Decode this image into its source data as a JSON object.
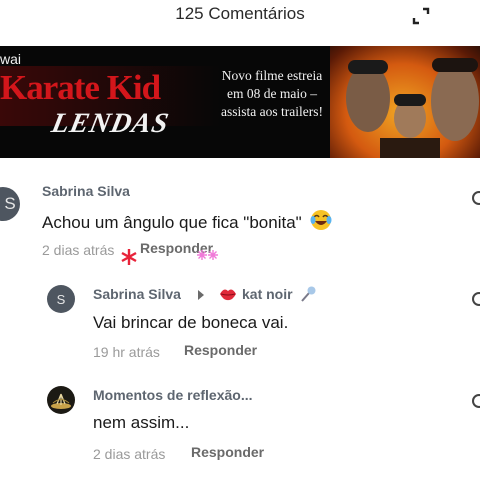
{
  "header": {
    "title": "125 Comentários"
  },
  "banner": {
    "brand": "wai",
    "movie_title": "Karate Kid",
    "movie_subtitle": "LENDAS",
    "promo_text": "Novo filme estreia em 08 de maio – assista aos trailers!"
  },
  "comments": [
    {
      "author": "Sabrina Silva",
      "avatar_letter": "S",
      "text": "Achou um ângulo que fica \"bonita\"",
      "emoji": "laughing-tears-emoji",
      "time": "2 dias atrás",
      "reply_label": "Responder"
    },
    {
      "author": "Sabrina Silva",
      "avatar_letter": "S",
      "reply_to": "kat noir",
      "text": "Vai brincar de boneca vai.",
      "time": "19 hr atrás",
      "reply_label": "Responder"
    },
    {
      "author": "Momentos de reflexão...",
      "text": "nem assim...",
      "time": "2 dias atrás",
      "reply_label": "Responder"
    }
  ],
  "colors": {
    "banner_bg": "#070707",
    "title_red": "#d3161b",
    "avatar_bg": "#4e5660",
    "author_grey": "#5e6670",
    "time_grey": "#9a9a9a"
  }
}
